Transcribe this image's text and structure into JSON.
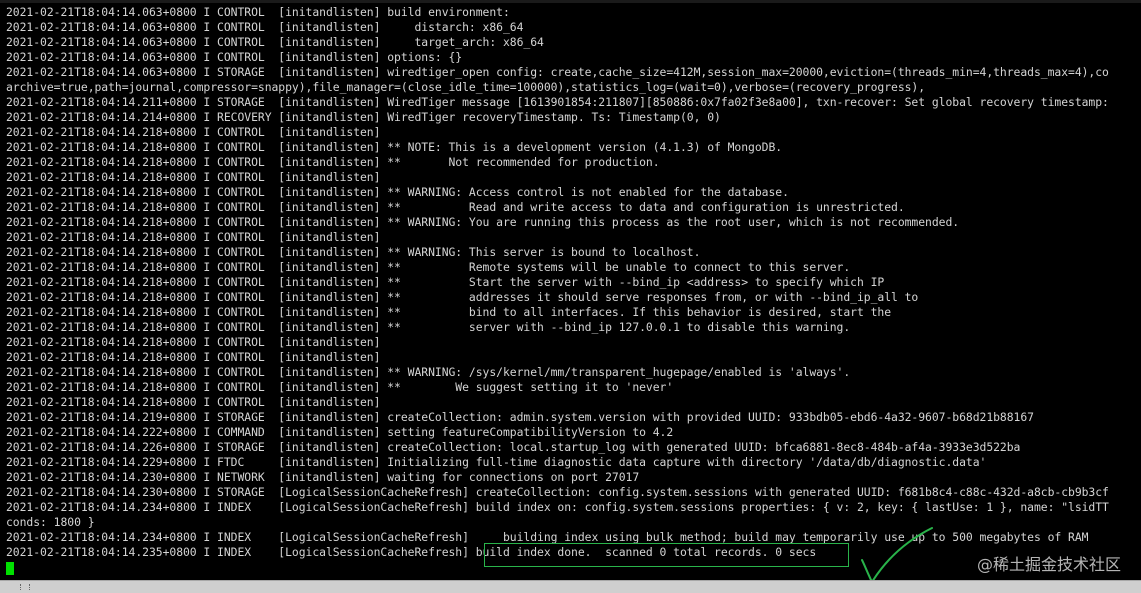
{
  "terminal": {
    "lines": [
      "2021-02-21T18:04:14.063+0800 I CONTROL  [initandlisten] build environment:",
      "2021-02-21T18:04:14.063+0800 I CONTROL  [initandlisten]     distarch: x86_64",
      "2021-02-21T18:04:14.063+0800 I CONTROL  [initandlisten]     target_arch: x86_64",
      "2021-02-21T18:04:14.063+0800 I CONTROL  [initandlisten] options: {}",
      "2021-02-21T18:04:14.063+0800 I STORAGE  [initandlisten] wiredtiger_open config: create,cache_size=412M,session_max=20000,eviction=(threads_min=4,threads_max=4),co",
      "archive=true,path=journal,compressor=snappy),file_manager=(close_idle_time=100000),statistics_log=(wait=0),verbose=(recovery_progress),",
      "2021-02-21T18:04:14.211+0800 I STORAGE  [initandlisten] WiredTiger message [1613901854:211807][850886:0x7fa02f3e8a00], txn-recover: Set global recovery timestamp:",
      "2021-02-21T18:04:14.214+0800 I RECOVERY [initandlisten] WiredTiger recoveryTimestamp. Ts: Timestamp(0, 0)",
      "2021-02-21T18:04:14.218+0800 I CONTROL  [initandlisten]",
      "2021-02-21T18:04:14.218+0800 I CONTROL  [initandlisten] ** NOTE: This is a development version (4.1.3) of MongoDB.",
      "2021-02-21T18:04:14.218+0800 I CONTROL  [initandlisten] **       Not recommended for production.",
      "2021-02-21T18:04:14.218+0800 I CONTROL  [initandlisten]",
      "2021-02-21T18:04:14.218+0800 I CONTROL  [initandlisten] ** WARNING: Access control is not enabled for the database.",
      "2021-02-21T18:04:14.218+0800 I CONTROL  [initandlisten] **          Read and write access to data and configuration is unrestricted.",
      "2021-02-21T18:04:14.218+0800 I CONTROL  [initandlisten] ** WARNING: You are running this process as the root user, which is not recommended.",
      "2021-02-21T18:04:14.218+0800 I CONTROL  [initandlisten]",
      "2021-02-21T18:04:14.218+0800 I CONTROL  [initandlisten] ** WARNING: This server is bound to localhost.",
      "2021-02-21T18:04:14.218+0800 I CONTROL  [initandlisten] **          Remote systems will be unable to connect to this server.",
      "2021-02-21T18:04:14.218+0800 I CONTROL  [initandlisten] **          Start the server with --bind_ip <address> to specify which IP",
      "2021-02-21T18:04:14.218+0800 I CONTROL  [initandlisten] **          addresses it should serve responses from, or with --bind_ip_all to",
      "2021-02-21T18:04:14.218+0800 I CONTROL  [initandlisten] **          bind to all interfaces. If this behavior is desired, start the",
      "2021-02-21T18:04:14.218+0800 I CONTROL  [initandlisten] **          server with --bind_ip 127.0.0.1 to disable this warning.",
      "2021-02-21T18:04:14.218+0800 I CONTROL  [initandlisten]",
      "2021-02-21T18:04:14.218+0800 I CONTROL  [initandlisten]",
      "2021-02-21T18:04:14.218+0800 I CONTROL  [initandlisten] ** WARNING: /sys/kernel/mm/transparent_hugepage/enabled is 'always'.",
      "2021-02-21T18:04:14.218+0800 I CONTROL  [initandlisten] **        We suggest setting it to 'never'",
      "2021-02-21T18:04:14.218+0800 I CONTROL  [initandlisten]",
      "2021-02-21T18:04:14.219+0800 I STORAGE  [initandlisten] createCollection: admin.system.version with provided UUID: 933bdb05-ebd6-4a32-9607-b68d21b88167",
      "2021-02-21T18:04:14.222+0800 I COMMAND  [initandlisten] setting featureCompatibilityVersion to 4.2",
      "2021-02-21T18:04:14.226+0800 I STORAGE  [initandlisten] createCollection: local.startup_log with generated UUID: bfca6881-8ec8-484b-af4a-3933e3d522ba",
      "2021-02-21T18:04:14.229+0800 I FTDC     [initandlisten] Initializing full-time diagnostic data capture with directory '/data/db/diagnostic.data'",
      "2021-02-21T18:04:14.230+0800 I NETWORK  [initandlisten] waiting for connections on port 27017",
      "2021-02-21T18:04:14.230+0800 I STORAGE  [LogicalSessionCacheRefresh] createCollection: config.system.sessions with generated UUID: f681b8c4-c88c-432d-a8cb-cb9b3cf",
      "2021-02-21T18:04:14.234+0800 I INDEX    [LogicalSessionCacheRefresh] build index on: config.system.sessions properties: { v: 2, key: { lastUse: 1 }, name: \"lsidTT",
      "conds: 1800 }",
      "2021-02-21T18:04:14.234+0800 I INDEX    [LogicalSessionCacheRefresh]     building index using bulk method; build may temporarily use up to 500 megabytes of RAM",
      "2021-02-21T18:04:14.235+0800 I INDEX    [LogicalSessionCacheRefresh] build index done.  scanned 0 total records. 0 secs"
    ]
  },
  "watermark": "@稀土掘金技术社区",
  "colors": {
    "background": "#000000",
    "text": "#d4d4d4",
    "cursor": "#00e000",
    "annotation": "#29b34a"
  }
}
